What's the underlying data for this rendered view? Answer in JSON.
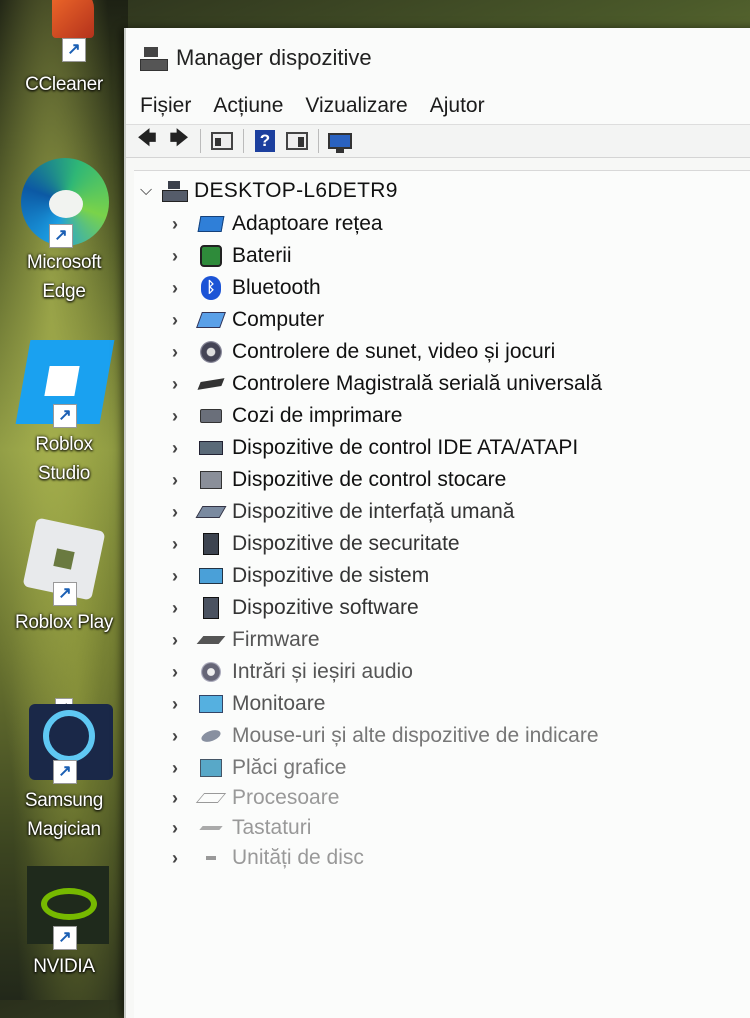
{
  "desktop": {
    "icons": [
      {
        "label_lines": [
          "CCleaner"
        ],
        "icon": "ccleaner-icon"
      },
      {
        "label_lines": [
          "Microsoft",
          "Edge"
        ],
        "icon": "edge-icon"
      },
      {
        "label_lines": [
          "Roblox",
          "Studio"
        ],
        "icon": "roblox-studio-icon"
      },
      {
        "label_lines": [
          "Roblox Play"
        ],
        "icon": "roblox-player-icon"
      },
      {
        "label_lines": [
          "Samsung",
          "Magician"
        ],
        "icon": "samsung-magician-icon"
      },
      {
        "label_lines": [
          "NVIDIA"
        ],
        "icon": "nvidia-icon"
      }
    ],
    "shortcut_glyph": "↗"
  },
  "window": {
    "title": "Manager dispozitive",
    "menu": [
      "Fișier",
      "Acțiune",
      "Vizualizare",
      "Ajutor"
    ],
    "toolbar": [
      "back-icon",
      "forward-icon",
      "properties-icon",
      "help-icon",
      "details-icon",
      "monitor-icon"
    ],
    "toolbar_glyphs": {
      "back": "🡄",
      "forward": "🡆",
      "help": "?"
    }
  },
  "tree": {
    "root": "DESKTOP-L6DETR9",
    "items": [
      {
        "label": "Adaptoare rețea",
        "icon": "network-adapter-icon"
      },
      {
        "label": "Baterii",
        "icon": "battery-icon"
      },
      {
        "label": "Bluetooth",
        "icon": "bluetooth-icon"
      },
      {
        "label": "Computer",
        "icon": "computer-icon"
      },
      {
        "label": "Controlere de sunet, video și jocuri",
        "icon": "speaker-icon"
      },
      {
        "label": "Controlere Magistrală serială universală",
        "icon": "usb-icon"
      },
      {
        "label": "Cozi de imprimare",
        "icon": "printer-icon"
      },
      {
        "label": "Dispozitive de control IDE ATA/ATAPI",
        "icon": "ide-controller-icon"
      },
      {
        "label": "Dispozitive de control stocare",
        "icon": "storage-controller-icon"
      },
      {
        "label": "Dispozitive de interfață umană",
        "icon": "hid-icon"
      },
      {
        "label": "Dispozitive de securitate",
        "icon": "security-device-icon"
      },
      {
        "label": "Dispozitive de sistem",
        "icon": "system-device-icon"
      },
      {
        "label": "Dispozitive software",
        "icon": "software-device-icon"
      },
      {
        "label": "Firmware",
        "icon": "firmware-icon"
      },
      {
        "label": "Intrări și ieșiri audio",
        "icon": "audio-io-icon"
      },
      {
        "label": "Monitoare",
        "icon": "monitor-icon"
      },
      {
        "label": "Mouse-uri și alte dispozitive de indicare",
        "icon": "mouse-icon"
      },
      {
        "label": "Plăci grafice",
        "icon": "display-adapter-icon"
      },
      {
        "label": "Procesoare",
        "icon": "processor-icon"
      },
      {
        "label": "Tastaturi",
        "icon": "keyboard-icon"
      },
      {
        "label": "Unități de disc",
        "icon": "disk-drive-icon"
      }
    ]
  }
}
